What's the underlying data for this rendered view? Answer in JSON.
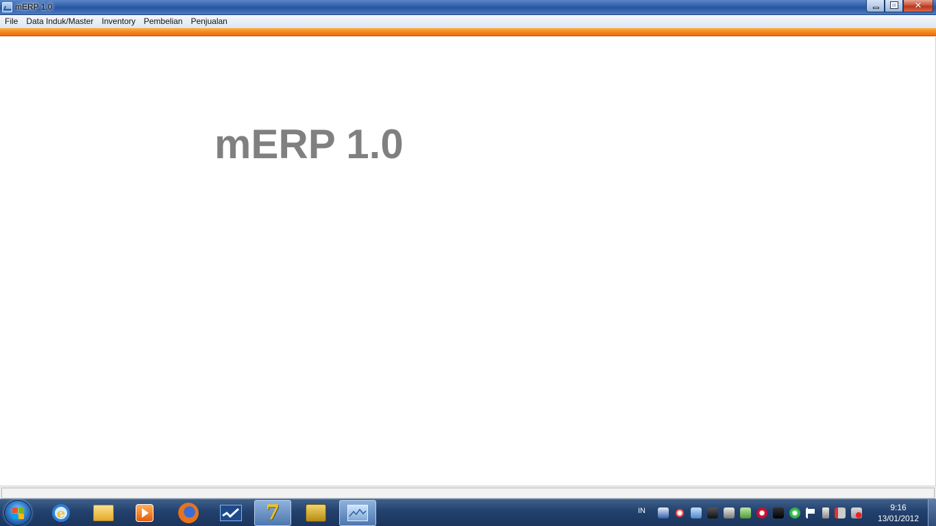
{
  "window": {
    "title": "mERP 1.0",
    "close_glyph": "✕"
  },
  "menu": {
    "items": [
      "File",
      "Data Induk/Master",
      "Inventory",
      "Pembelian",
      "Penjualan"
    ]
  },
  "main": {
    "splash_title": "mERP 1.0"
  },
  "taskbar": {
    "apps": [
      "internet-explorer-icon",
      "windows-explorer-icon",
      "media-player-icon",
      "firefox-icon",
      "app-wave-icon",
      "seven-app-icon",
      "database-app-icon",
      "merp-app-icon"
    ],
    "seven_glyph": "7",
    "ie_glyph": "e",
    "language": "IN",
    "time": "9:16",
    "date": "13/01/2012"
  },
  "colors": {
    "accent_orange": "#f68b1f",
    "title_blue": "#2f5ea8",
    "splash_gray": "#808080"
  }
}
